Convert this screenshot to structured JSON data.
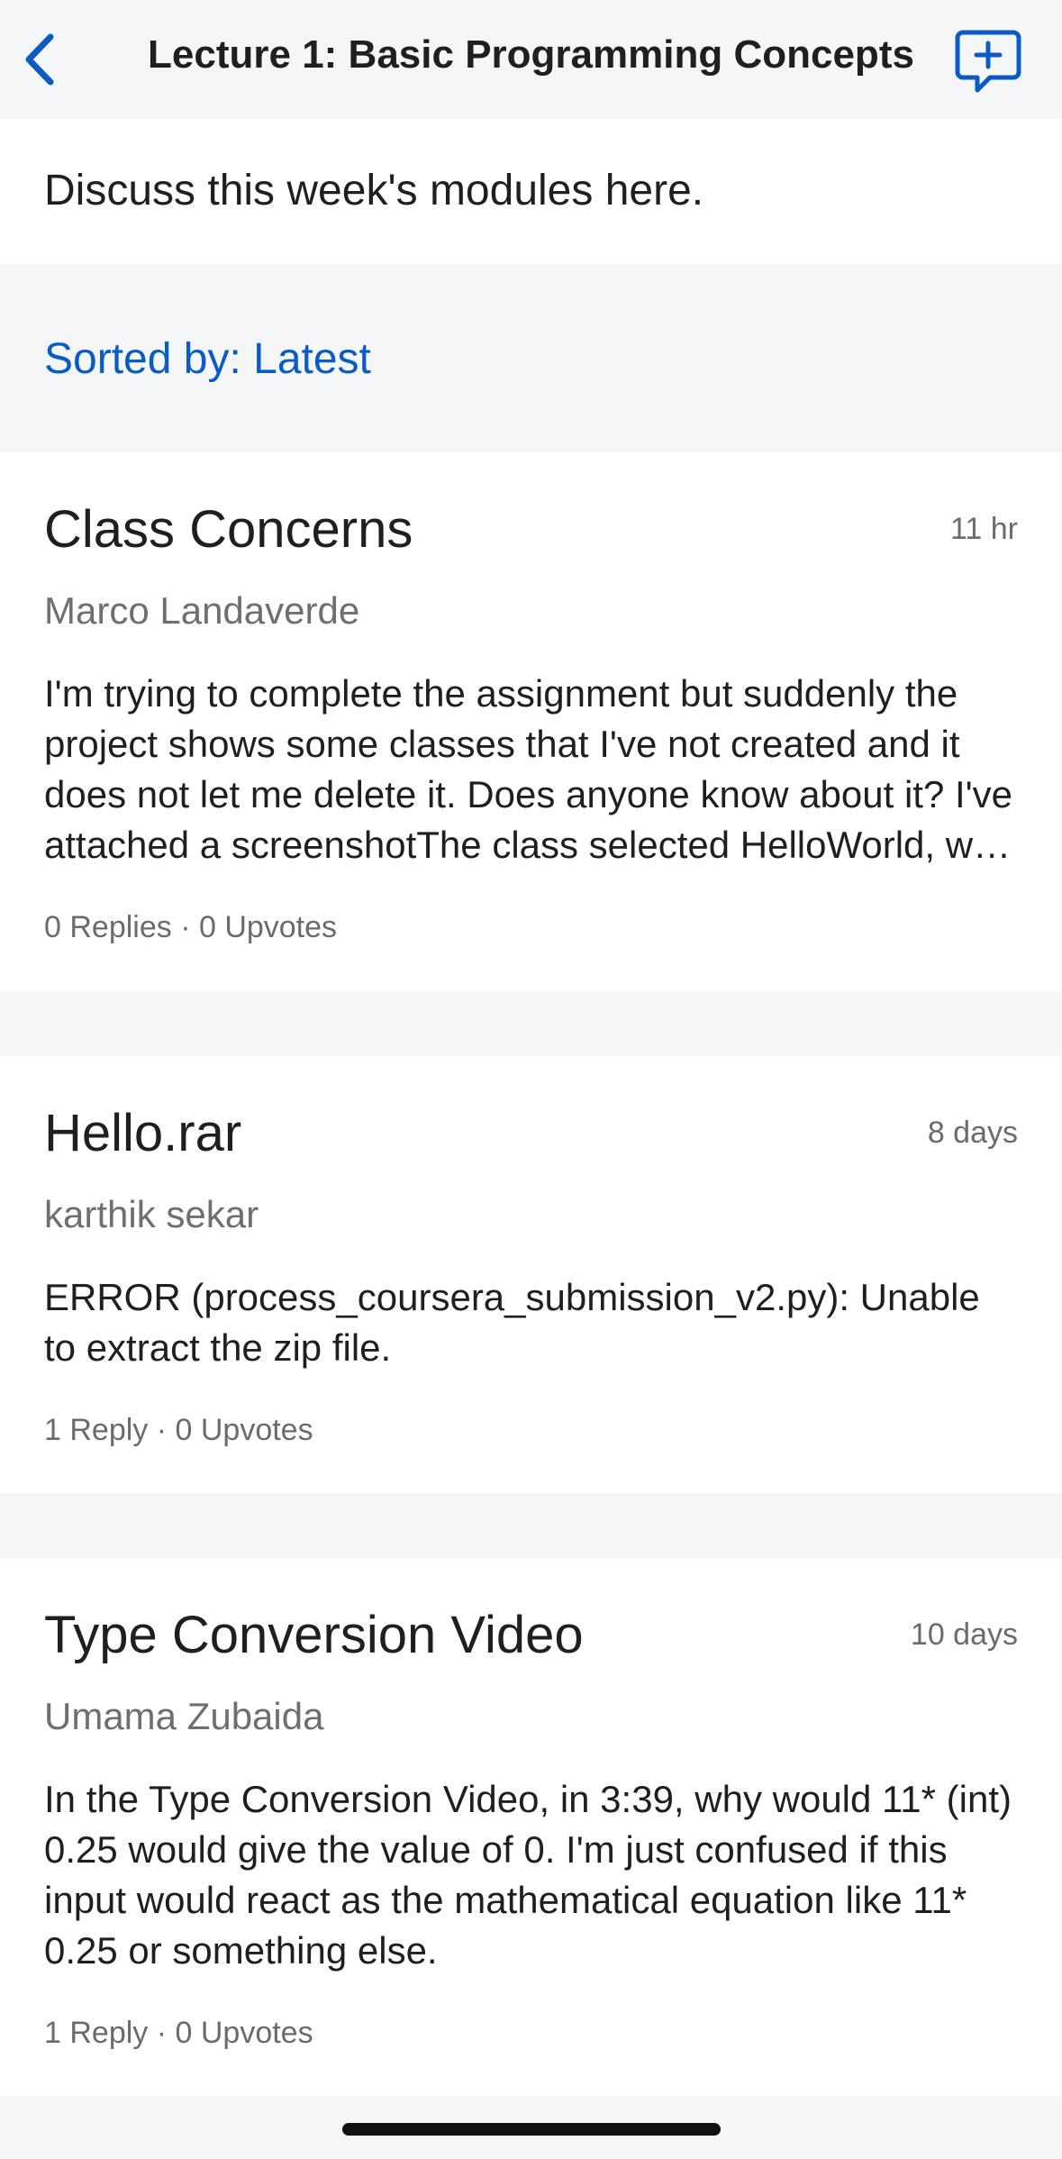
{
  "header": {
    "title": "Lecture 1: Basic Programming Concepts",
    "back_icon": "chevron-left-icon",
    "compose_icon": "new-post-icon",
    "accent_color": "#0a5bc4"
  },
  "description": "Discuss this week's modules here.",
  "sort": {
    "label": "Sorted by: Latest"
  },
  "posts": [
    {
      "title": "Class Concerns",
      "time": "11 hr",
      "author": "Marco Landaverde",
      "body": "I'm trying to complete the assignment but suddenly the project shows some classes that I've not created and it does not let me delete it. Does anyone know about it? I've attached a screenshotThe class selected HelloWorld, w…",
      "meta": "0 Replies · 0 Upvotes"
    },
    {
      "title": "Hello.rar",
      "time": "8 days",
      "author": "karthik sekar",
      "body": "ERROR (process_coursera_submission_v2.py): Unable to extract the zip file.",
      "meta": "1 Reply · 0 Upvotes"
    },
    {
      "title": "Type Conversion Video",
      "time": "10 days",
      "author": "Umama Zubaida",
      "body": "In the Type Conversion Video, in 3:39, why would 11* (int) 0.25 would give the value of 0. I'm just confused if this input would react as the mathematical equation like 11* 0.25 or something else.",
      "meta": "1 Reply · 0 Upvotes"
    }
  ]
}
